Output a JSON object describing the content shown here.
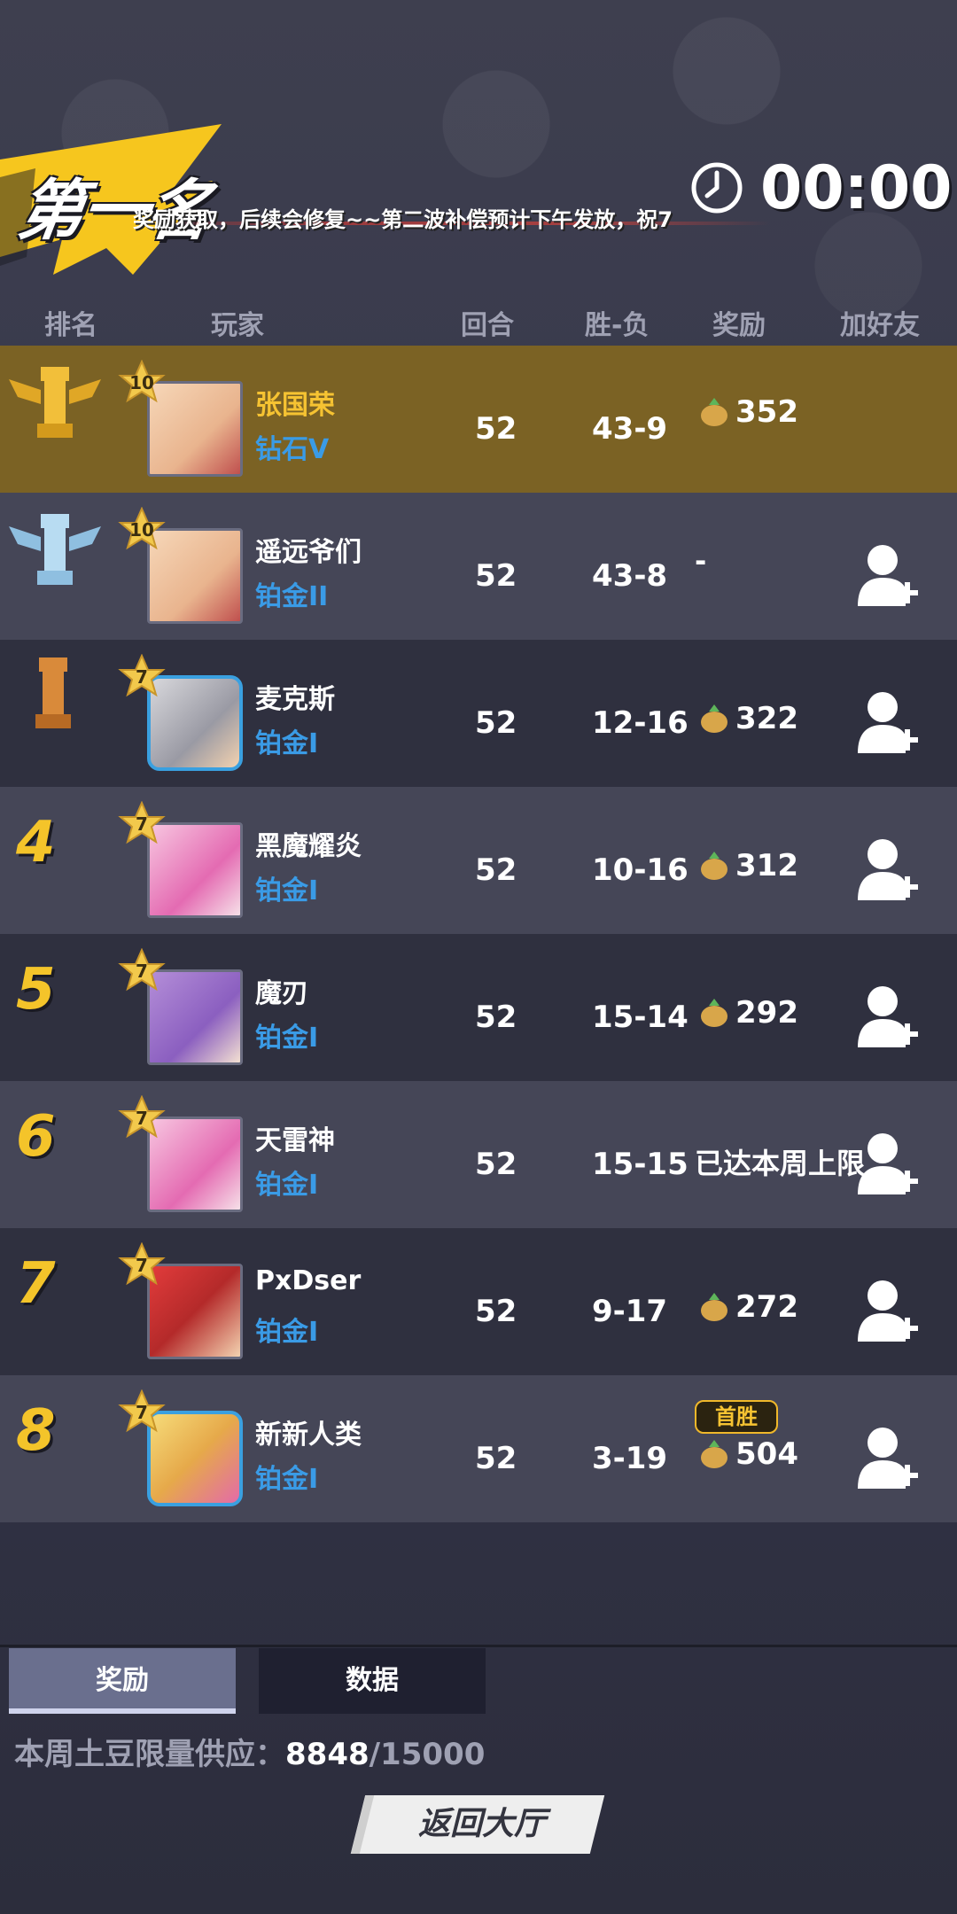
{
  "header": {
    "title": "第一名",
    "marquee": "奖励获取，后续会修复~~第二波补偿预计下午发放，祝7",
    "timer": "00:00"
  },
  "columns": {
    "rank": "排名",
    "player": "玩家",
    "rounds": "回合",
    "win_loss": "胜-负",
    "reward": "奖励",
    "add_friend": "加好友"
  },
  "rows": [
    {
      "rank": "1",
      "level": "10",
      "name": "张国荣",
      "tier": "钻石V",
      "rounds": "52",
      "wl": "43-9",
      "reward": "352",
      "reward_note": "",
      "first_win": "",
      "add_friend": false
    },
    {
      "rank": "2",
      "level": "10",
      "name": "遥远爷们",
      "tier": "铂金II",
      "rounds": "52",
      "wl": "43-8",
      "reward": "-",
      "reward_note": "",
      "first_win": "",
      "add_friend": true
    },
    {
      "rank": "3",
      "level": "7",
      "name": "麦克斯",
      "tier": "铂金I",
      "rounds": "52",
      "wl": "12-16",
      "reward": "322",
      "reward_note": "",
      "first_win": "",
      "add_friend": true
    },
    {
      "rank": "4",
      "level": "7",
      "name": "黑魔耀炎",
      "tier": "铂金I",
      "rounds": "52",
      "wl": "10-16",
      "reward": "312",
      "reward_note": "",
      "first_win": "",
      "add_friend": true
    },
    {
      "rank": "5",
      "level": "7",
      "name": "魔刃",
      "tier": "铂金I",
      "rounds": "52",
      "wl": "15-14",
      "reward": "292",
      "reward_note": "",
      "first_win": "",
      "add_friend": true
    },
    {
      "rank": "6",
      "level": "7",
      "name": "天雷神",
      "tier": "铂金I",
      "rounds": "52",
      "wl": "15-15",
      "reward": "",
      "reward_note": "已达本周上限",
      "first_win": "",
      "add_friend": true
    },
    {
      "rank": "7",
      "level": "7",
      "name": "PxDser",
      "tier": "铂金I",
      "rounds": "52",
      "wl": "9-17",
      "reward": "272",
      "reward_note": "",
      "first_win": "",
      "add_friend": true
    },
    {
      "rank": "8",
      "level": "7",
      "name": "新新人类",
      "tier": "铂金I",
      "rounds": "52",
      "wl": "3-19",
      "reward": "504",
      "reward_note": "",
      "first_win": "首胜",
      "add_friend": true
    }
  ],
  "tabs": {
    "rewards": "奖励",
    "data": "数据"
  },
  "supply": {
    "label": "本周土豆限量供应：",
    "current": "8848",
    "total": "/15000"
  },
  "back_button": "返回大厅",
  "colors": {
    "highlight_row": "#7b6224",
    "gold_text": "#f6c332",
    "tier_blue": "#3a9be6"
  }
}
